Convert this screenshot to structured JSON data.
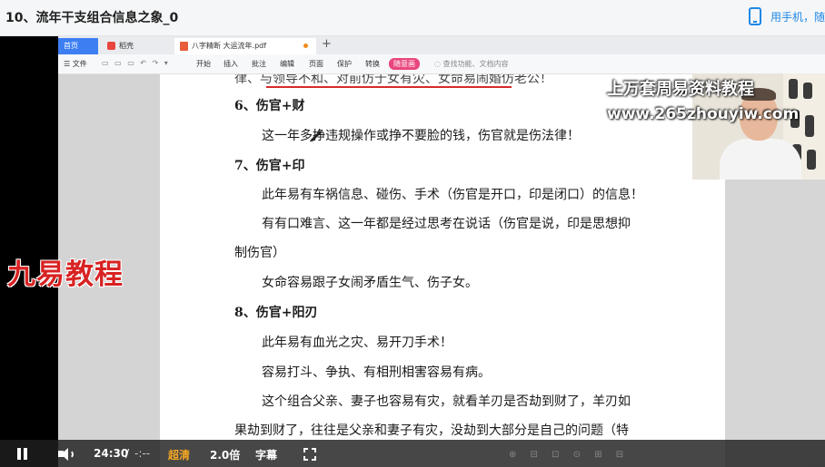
{
  "header": {
    "title": "10、流年干支组合信息之象_0",
    "phone_label": "用手机，随"
  },
  "wps": {
    "tabs": {
      "home": "首页",
      "docer": "稻壳",
      "pdf": "八字精断 大运流年.pdf",
      "new_tab": "+"
    },
    "menu": {
      "file": "☰ 文件",
      "tools": "▭ ▭ ▭ ↶ ↷ ▾",
      "start": "开始",
      "insert": "插入",
      "annotate": "批注",
      "edit": "编辑",
      "page": "页面",
      "protect": "保护",
      "convert": "转换",
      "translate": "随意画",
      "search": "◌ 查找功能、文档内容"
    }
  },
  "document": {
    "top_partial": "律、与领导不和、对前仿于女有灾、女命易闹婚仿老公！",
    "lines": [
      "6、伤官+财",
      "这一年多挣违规操作或挣不要脸的钱，伤官就是伤法律！",
      "7、伤官+印",
      "此年易有车祸信息、碰伤、手术（伤官是开口，印是闭口）的信息！",
      "有有口难言、这一年都是经过思考在说话（伤官是说，印是思想抑",
      "制伤官）",
      "女命容易跟子女闹矛盾生气、伤子女。",
      "8、伤官+阳刃",
      "此年易有血光之灾、易开刀手术！",
      "容易打斗、争执、有相刑相害容易有病。",
      "这个组合父亲、妻子也容易有灾，就看羊刃是否劫到财了，羊刃如",
      "果劫到财了，往往是父亲和妻子有灾，没劫到大部分是自己的问题（特"
    ]
  },
  "watermarks": {
    "left": "九易教程",
    "title": "上万套周易资料教程",
    "url": "www.265zhouyiw.com"
  },
  "player": {
    "current_time": "24:30",
    "separator": "/",
    "total_time": "-:--",
    "quality": "超清",
    "speed": "2.0倍",
    "subtitle": "字幕",
    "status_ghost": "⊕ ⊟ ⊡ ⊙ ⊞ ⊟"
  }
}
